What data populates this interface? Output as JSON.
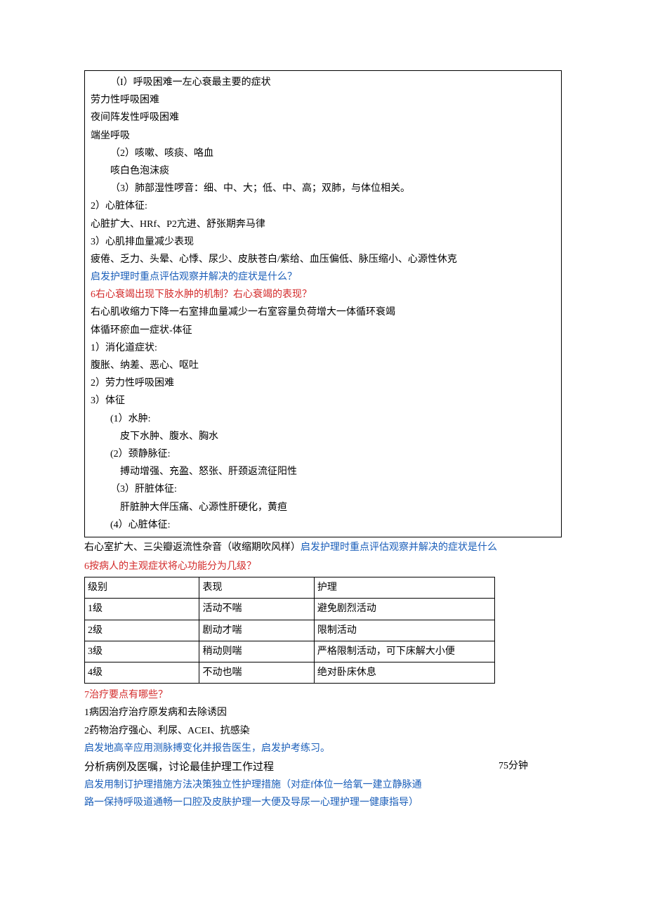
{
  "box1": {
    "l1": "（I）呼吸困难一左心衰最主要的症状",
    "l2": "劳力性呼吸困难",
    "l3": "夜间阵发性呼吸困难",
    "l4": "端坐呼吸",
    "l5": "（2）咳嗽、咳痰、咯血",
    "l6": "咳白色泡沫痰",
    "l7": "（3）肺部湿性啰音：细、中、大；低、中、高；双肺，与体位相关。",
    "l8": "2）心脏体征:",
    "l9": "心脏扩大、HRf、P2亢进、舒张期奔马律",
    "l10": "3）心肌排血量减少表现",
    "l11": "疲倦、乏力、头晕、心悸、尿少、皮肤苍白/紫给、血压偏低、脉压缩小、心源性休克",
    "l12": "启发护理时重点评估观察并解决的症状是什么？",
    "l13": "6右心衰竭出现下肢水肿的机制？右心衰竭的表现？",
    "l14": "右心肌收缩力下降一右室排血量减少一右室容量负荷增大一体循环衰竭",
    "l15": "体循环瘀血一症状-体征",
    "l16": "1）消化道症状:",
    "l17": "腹胀、纳差、恶心、呕吐",
    "l18": "2）劳力性呼吸困难",
    "l19": "3）体征",
    "l20": "(1）水肿:",
    "l21": "皮下水肿、腹水、胸水",
    "l22": "(2）颈静脉征:",
    "l23": "搏动增强、充盈、怒张、肝颈返流征阳性",
    "l24": "（3）肝脏体征:",
    "l25": "肝脏肿大伴压痛、心源性肝硬化，黄疸",
    "l26": "(4）心脏体征:"
  },
  "inter1a": "右心室扩大、三尖瓣返流性杂音（收缩期吹风样）",
  "inter1b": "启发护理时重点评估观察并解决的症状是什么",
  "inter2": "6按病人的主观症状将心功能分为几级？",
  "table": {
    "header": {
      "c1": "级别",
      "c2": "表现",
      "c3": "护理"
    },
    "rows": [
      {
        "c1": "1级",
        "c2": "活动不喘",
        "c3": "避免剧烈活动"
      },
      {
        "c1": "2级",
        "c2": "剧动才喘",
        "c3": "限制活动"
      },
      {
        "c1": "3级",
        "c2": "稍动则喘",
        "c3": "严格限制活动，可下床解大小便"
      },
      {
        "c1": "4级",
        "c2": "不动也喘",
        "c3": "绝对卧床休息"
      }
    ]
  },
  "after": {
    "l1": "7治疗要点有哪些？",
    "l2": "1病因治疗治疗原发病和去除诱因",
    "l3": "2药物治疗强心、利尿、ACEI、抗感染",
    "l4": "启发地高辛应用测脉搏变化并报告医生，启发护考练习。",
    "l5": "分析病例及医嘱，讨论最佳护理工作过程",
    "l5time": "75分钟",
    "l6": "启发用制订护理措施方法决策独立性护理措施（对症f体位一给氧一建立静脉通",
    "l7": "路一保持呼吸道通畅一口腔及皮肤护理一大便及导尿一心理护理一健康指导）"
  }
}
